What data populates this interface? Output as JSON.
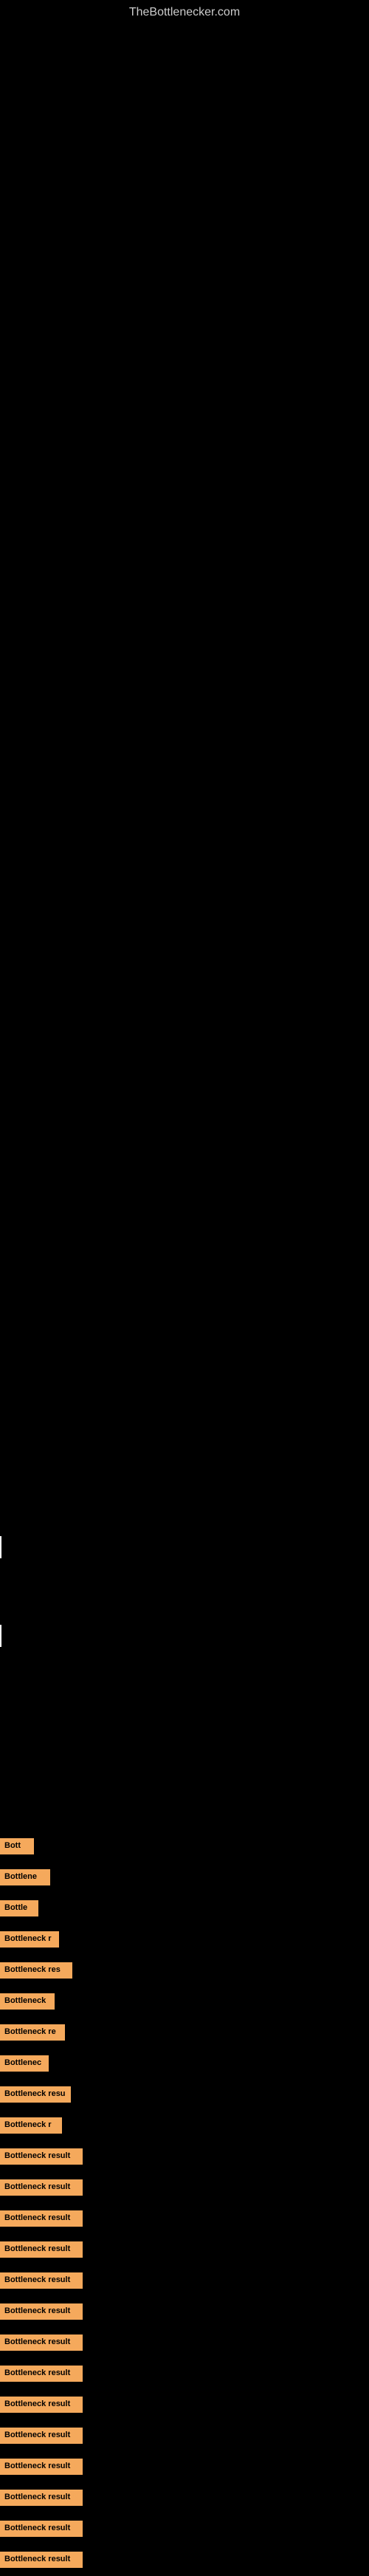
{
  "site": {
    "title": "TheBottlenecker.com"
  },
  "bottleneck_items": [
    {
      "id": 1,
      "label": "Bottleneck result",
      "display": "Bott"
    },
    {
      "id": 2,
      "label": "Bottleneck result",
      "display": "Bottlene"
    },
    {
      "id": 3,
      "label": "Bottleneck result",
      "display": "Bottle"
    },
    {
      "id": 4,
      "label": "Bottleneck result",
      "display": "Bottleneck r"
    },
    {
      "id": 5,
      "label": "Bottleneck result",
      "display": "Bottleneck res"
    },
    {
      "id": 6,
      "label": "Bottleneck result",
      "display": "Bottleneck"
    },
    {
      "id": 7,
      "label": "Bottleneck result",
      "display": "Bottleneck re"
    },
    {
      "id": 8,
      "label": "Bottleneck result",
      "display": "Bottlenec"
    },
    {
      "id": 9,
      "label": "Bottleneck result",
      "display": "Bottleneck resu"
    },
    {
      "id": 10,
      "label": "Bottleneck result",
      "display": "Bottleneck r"
    },
    {
      "id": 11,
      "label": "Bottleneck result",
      "display": "Bottleneck result"
    },
    {
      "id": 12,
      "label": "Bottleneck result",
      "display": "Bottleneck result"
    },
    {
      "id": 13,
      "label": "Bottleneck result",
      "display": "Bottleneck result"
    },
    {
      "id": 14,
      "label": "Bottleneck result",
      "display": "Bottleneck result"
    },
    {
      "id": 15,
      "label": "Bottleneck result",
      "display": "Bottleneck result"
    },
    {
      "id": 16,
      "label": "Bottleneck result",
      "display": "Bottleneck result"
    },
    {
      "id": 17,
      "label": "Bottleneck result",
      "display": "Bottleneck result"
    },
    {
      "id": 18,
      "label": "Bottleneck result",
      "display": "Bottleneck result"
    },
    {
      "id": 19,
      "label": "Bottleneck result",
      "display": "Bottleneck result"
    },
    {
      "id": 20,
      "label": "Bottleneck result",
      "display": "Bottleneck result"
    },
    {
      "id": 21,
      "label": "Bottleneck result",
      "display": "Bottleneck result"
    },
    {
      "id": 22,
      "label": "Bottleneck result",
      "display": "Bottleneck result"
    },
    {
      "id": 23,
      "label": "Bottleneck result",
      "display": "Bottleneck result"
    },
    {
      "id": 24,
      "label": "Bottleneck result",
      "display": "Bottleneck result"
    }
  ],
  "colors": {
    "background": "#000000",
    "badge_bg": "#f5a95c",
    "badge_text": "#000000",
    "site_title": "#cccccc"
  }
}
